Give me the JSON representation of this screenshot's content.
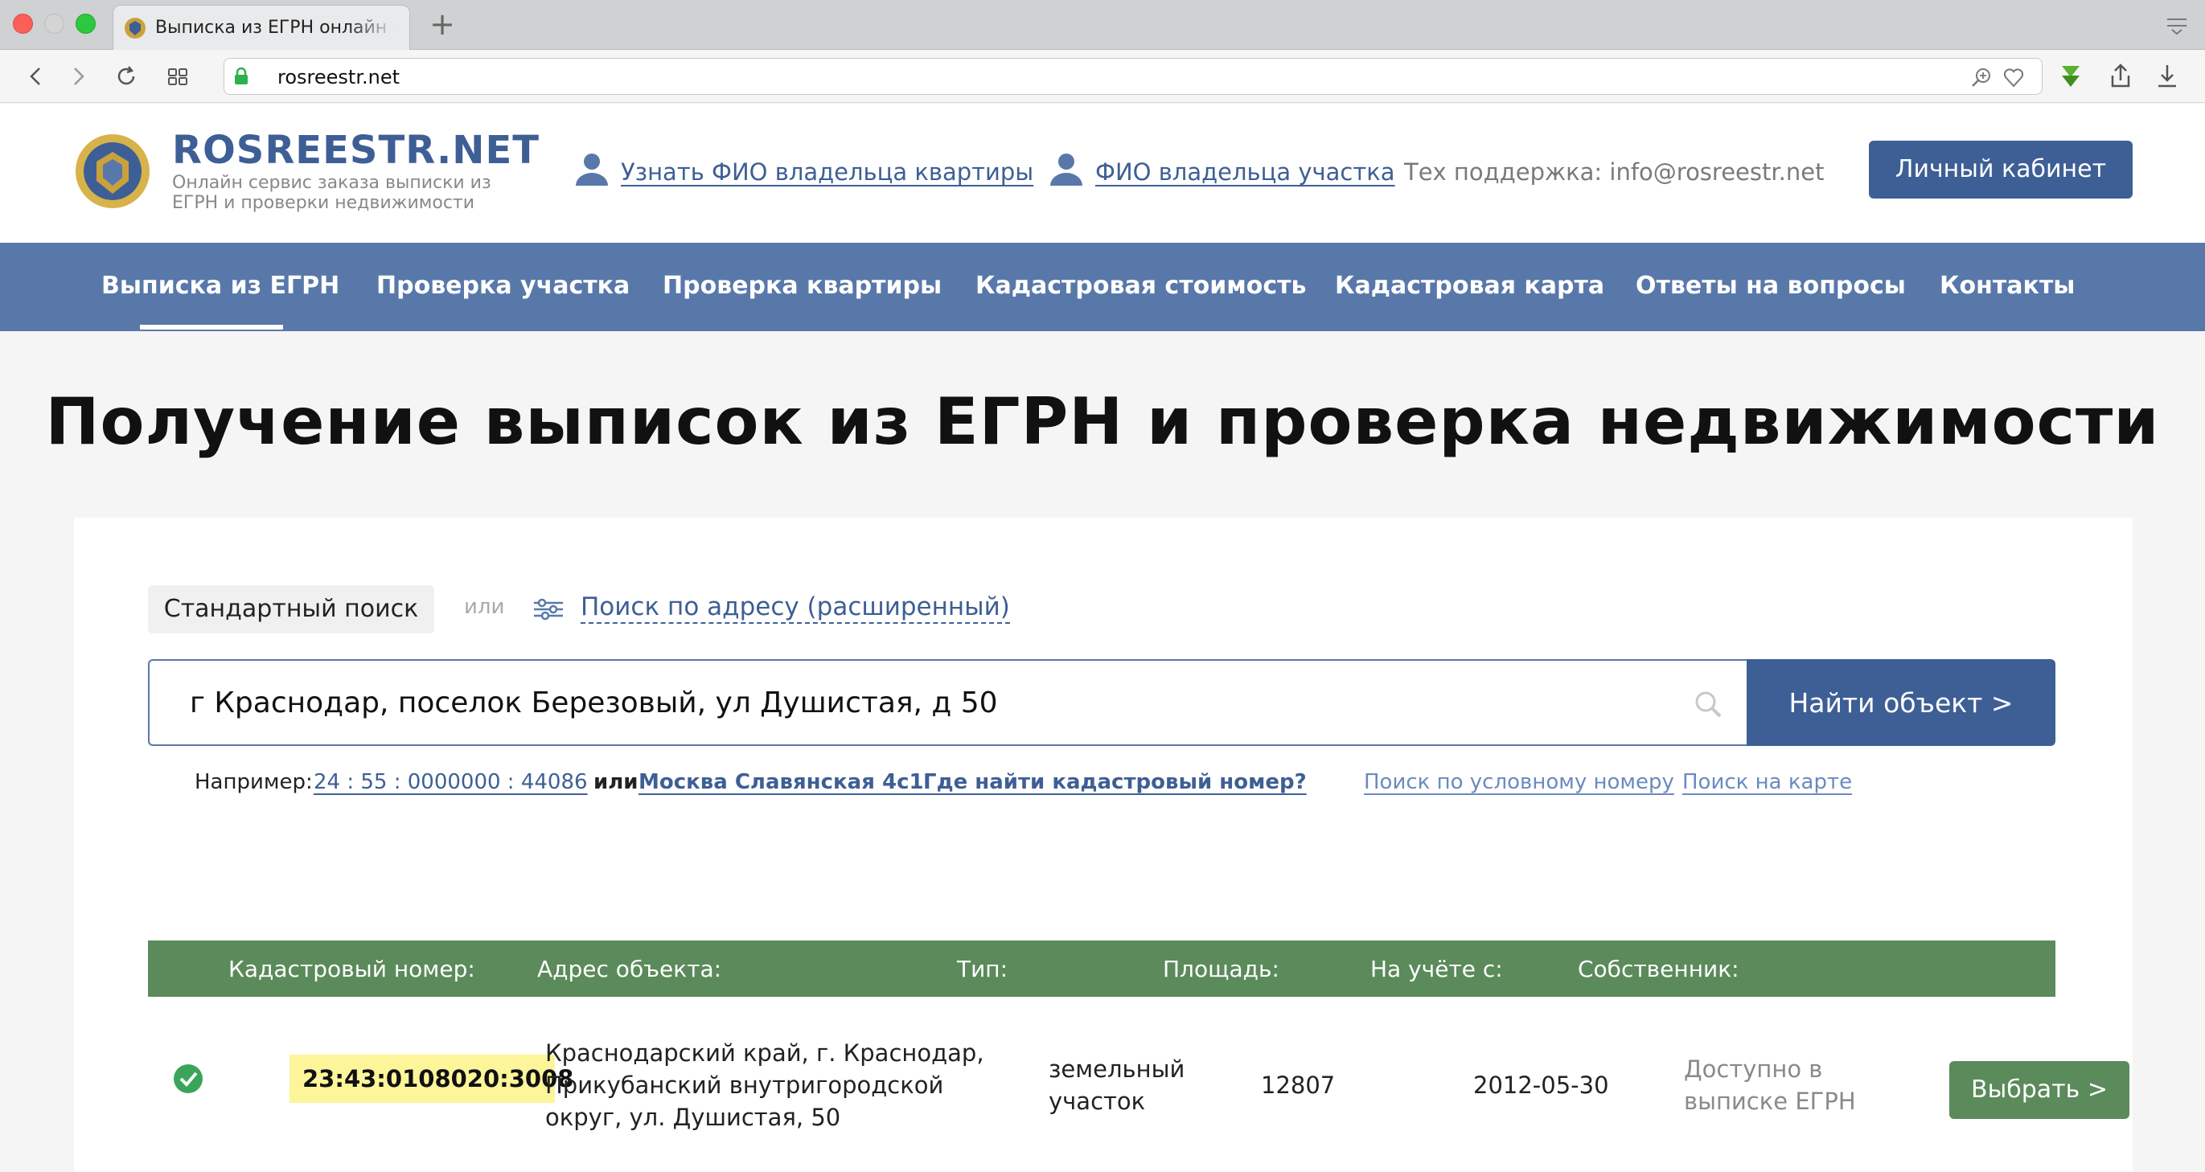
{
  "browser": {
    "tab_title": "Выписка из ЕГРН онлайн - с",
    "url": "rosreestr.net",
    "icons": [
      "back-icon",
      "forward-icon",
      "reload-icon",
      "tabs-grid-icon",
      "lock-icon",
      "zoom-icon",
      "heart-icon",
      "extension-icon",
      "share-icon",
      "download-icon",
      "tab-menu-icon"
    ]
  },
  "header": {
    "logo_title": "ROSREESTR.NET",
    "logo_subtitle_line1": "Онлайн сервис заказа выписки из",
    "logo_subtitle_line2": "ЕГРН и проверки недвижимости",
    "link_apartment_owner": "Узнать ФИО владельца квартиры",
    "link_plot_owner": "ФИО владельца участка",
    "support": "Тех поддержка: info@rosreestr.net",
    "cabinet_button": "Личный кабинет"
  },
  "nav": {
    "items": [
      {
        "label": "Выписка из ЕГРН",
        "active": true
      },
      {
        "label": "Проверка участка",
        "active": false
      },
      {
        "label": "Проверка квартиры",
        "active": false
      },
      {
        "label": "Кадастровая стоимость",
        "active": false
      },
      {
        "label": "Кадастровая карта",
        "active": false
      },
      {
        "label": "Ответы на вопросы",
        "active": false
      },
      {
        "label": "Контакты",
        "active": false
      }
    ]
  },
  "main": {
    "title": "Получение выписок из ЕГРН и проверка недвижимости",
    "search": {
      "standard_label": "Стандартный поиск",
      "or_label": "или",
      "advanced_link": "Поиск по адресу (расширенный)",
      "input_value": "г Краснодар, поселок Березовый, ул Душистая, д 50",
      "find_button": "Найти объект >",
      "examples": {
        "label": "Например:",
        "example_number": "24 : 55 : 0000000 : 44086",
        "or": "или",
        "example_address": "Москва Славянская 4с1",
        "where_to_find": "Где найти кадастровый номер?",
        "by_conditional_number": "Поиск по условному номеру",
        "on_map": "Поиск на карте"
      }
    },
    "results": {
      "headers": {
        "cadastral": "Кадастровый номер:",
        "address": "Адрес объекта:",
        "type": "Тип:",
        "area": "Площадь:",
        "registered": "На учёте с:",
        "owner": "Собственник:"
      },
      "rows": [
        {
          "cadastral": "23:43:0108020:3008",
          "address_line1": "Краснодарский край, г. Краснодар,",
          "address_line2": "Прикубанский внутригородской",
          "address_line3": "округ, ул. Душистая, 50",
          "type_line1": "земельный",
          "type_line2": "участок",
          "area": "12807",
          "registered": "2012-05-30",
          "owner_line1": "Доступно в",
          "owner_line2": "выписке ЕГРН",
          "select_button": "Выбрать >"
        }
      ]
    }
  },
  "colors": {
    "brand_blue": "#3e5f95",
    "nav_blue": "#5978aa",
    "table_green": "#5b8a5b",
    "highlight_yellow": "#fdf59a"
  }
}
